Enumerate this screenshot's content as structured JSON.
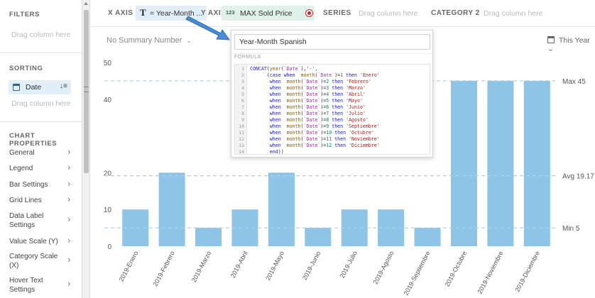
{
  "left_panel": {
    "filters": {
      "title": "FILTERS",
      "hint": "Drag column here"
    },
    "sorting": {
      "title": "SORTING",
      "chip_label": "Date",
      "hint": "Drag column here"
    },
    "chart_properties": {
      "title": "CHART PROPERTIES",
      "items": [
        {
          "label": "General"
        },
        {
          "label": "Legend"
        },
        {
          "label": "Bar Settings"
        },
        {
          "label": "Grid Lines"
        },
        {
          "label": "Data Label Settings"
        },
        {
          "label": "Value Scale (Y)"
        },
        {
          "label": "Category Scale (X)"
        },
        {
          "label": "Hover Text Settings"
        }
      ]
    }
  },
  "top_bar": {
    "x_axis_label": "X AXIS",
    "x_chip": "= Year-Month ...",
    "x_chip_icon": "T",
    "y_axis_label": "Y AXIS",
    "y_chip": "MAX Sold Price",
    "y_chip_icon": "123",
    "series_label": "SERIES",
    "series_hint": "Drag column here",
    "category2_label": "CATEGORY 2",
    "category2_hint": "Drag column here"
  },
  "toolbar": {
    "summary": "No Summary Number",
    "date_filter": "This Year"
  },
  "popup": {
    "name_value": "Year-Month Spanish",
    "formula_label": "FORMULA",
    "code_lines": [
      [
        "CONCAT(year(`Date`),'-',"
      ],
      [
        "      (case when  month(`Date`)=1 then 'Enero'"
      ],
      [
        "       when  month(`Date`)=2 then 'Febrero'"
      ],
      [
        "       when  month(`Date`)=3 then 'Marzo'"
      ],
      [
        "       when  month(`Date`)=4 then 'Abril'"
      ],
      [
        "       when  month(`Date`)=5 then 'Mayo'"
      ],
      [
        "       when  month(`Date`)=6 then 'Junio'"
      ],
      [
        "       when  month(`Date`)=7 then 'Julio'"
      ],
      [
        "       when  month(`Date`)=8 then 'Agosto'"
      ],
      [
        "       when  month(`Date`)=9 then 'Septiembre'"
      ],
      [
        "       when  month(`Date`)=10 then 'Octubre'"
      ],
      [
        "       when  month(`Date`)=11 then 'Noviembre'"
      ],
      [
        "       when  month(`Date`)=12 then 'Diciembre'"
      ],
      [
        "       end))"
      ]
    ]
  },
  "colors": {
    "bar": "#8ec4e6",
    "ref_line": "#a9d4ee",
    "accent": "#4a8bd6",
    "red": "#c62828"
  },
  "chart_data": {
    "type": "bar",
    "categories": [
      "2019-Enero",
      "2019-Febrero",
      "2019-Marzo",
      "2019-Abril",
      "2019-Mayo",
      "2019-Junio",
      "2019-Julio",
      "2019-Agosto",
      "2019-Septiembre",
      "2019-Octubre",
      "2019-Noviembre",
      "2019-Diciembre"
    ],
    "series": [
      {
        "values": [
          10,
          20,
          5,
          10,
          20,
          5,
          10,
          10,
          5,
          45,
          45,
          45
        ]
      }
    ],
    "yticks": [
      0,
      10,
      20,
      40,
      50
    ],
    "ylim": [
      0,
      50
    ],
    "reference_lines": [
      {
        "label": "Max 45",
        "value": 45
      },
      {
        "label": "Avg 19.17",
        "value": 19.17
      },
      {
        "label": "Min 5",
        "value": 5
      }
    ],
    "grid": false
  }
}
